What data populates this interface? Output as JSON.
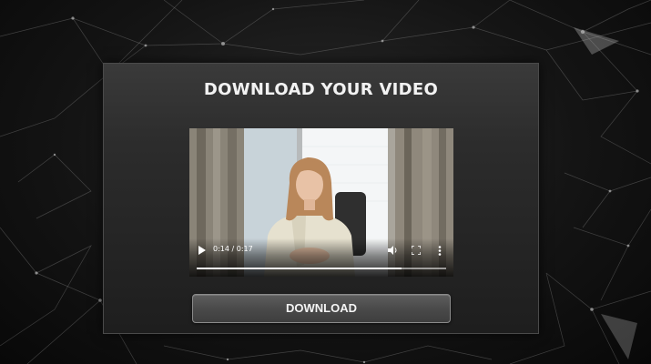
{
  "page": {
    "title": "DOWNLOAD YOUR VIDEO"
  },
  "video": {
    "current_time": "0:14",
    "duration": "0:17",
    "time_display": "0:14 / 0:17",
    "progress": 0.82
  },
  "download": {
    "label": "DOWNLOAD"
  },
  "icons": {
    "play": "play-icon",
    "volume": "volume-icon",
    "fullscreen": "fullscreen-icon",
    "more": "more-vertical-icon"
  },
  "colors": {
    "background": "#0d0d0d",
    "card": "#2c2c2c",
    "button": "#4a4a4a",
    "title_text": "#f2f2f2"
  }
}
